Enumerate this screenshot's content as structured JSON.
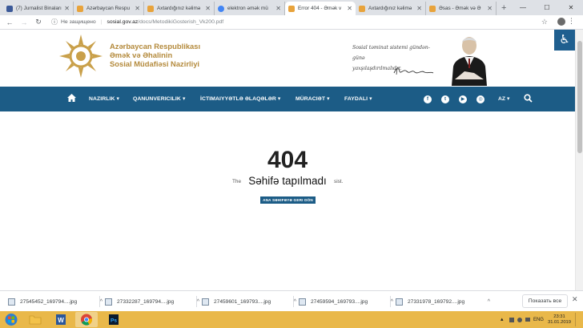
{
  "browser": {
    "tabs": [
      {
        "title": "(7) Jurnalist Binaları",
        "favicon_color": "#3b5998"
      },
      {
        "title": "Azərbaycan Respu",
        "favicon_color": "#e8a33b"
      },
      {
        "title": "Axtardığınız kəlimə",
        "favicon_color": "#e8a33b"
      },
      {
        "title": "elektron əmək mü",
        "favicon_color": "#4285f4"
      },
      {
        "title": "Error 404 - Əmək v",
        "favicon_color": "#e8a33b",
        "active": true
      },
      {
        "title": "Axtardığınız kəlimə",
        "favicon_color": "#e8a33b"
      },
      {
        "title": "Əsas - Əmək və Ə",
        "favicon_color": "#e8a33b"
      }
    ],
    "new_tab": "+",
    "window_controls": {
      "minimize": "—",
      "maximize": "☐",
      "close": "✕"
    },
    "nav": {
      "back": "←",
      "forward": "→",
      "reload": "↻"
    },
    "security_label": "Не защищено",
    "url_host": "sosial.gov.az",
    "url_path": "/docs/MetodikiGosterish_Vk200.pdf"
  },
  "header": {
    "org_line1": "Azərbaycan Respublikası",
    "org_line2": "Əmək və Əhalinin",
    "org_line3": "Sosial Müdafiəsi Nazirliyi",
    "quote_line1": "Sosial təminat sistemi gündən-günə",
    "quote_line2": "yaxşılaşdırılmalıdır.",
    "accessibility_icon": "wheelchair-icon"
  },
  "nav": {
    "items": [
      "NAZIRLIK",
      "QANUNVERICILIK",
      "İCTIMAIYYƏTLƏ ƏLAQƏLƏR",
      "MÜRACIƏT",
      "FAYDALI"
    ],
    "social": [
      "f",
      "t",
      "▶",
      "◎"
    ],
    "lang": "AZ"
  },
  "error": {
    "code": "404",
    "title": "Səhifə tapılmadı",
    "behind_left": "The",
    "behind_right": "sist.",
    "button": "ANA SƏHIFƏYƏ GERI DÖN"
  },
  "downloads": {
    "items": [
      "27545452_169794....jpg",
      "27332287_169794....jpg",
      "27459601_169793....jpg",
      "27459594_169793....jpg",
      "27331978_169792....jpg"
    ],
    "show_all": "Показать все"
  },
  "taskbar": {
    "lang": "ENG",
    "time": "23:31",
    "date": "31.01.2019"
  },
  "colors": {
    "brand_blue": "#1c5c86",
    "brand_gold": "#b48a3c",
    "taskbar": "#e9b84a"
  }
}
